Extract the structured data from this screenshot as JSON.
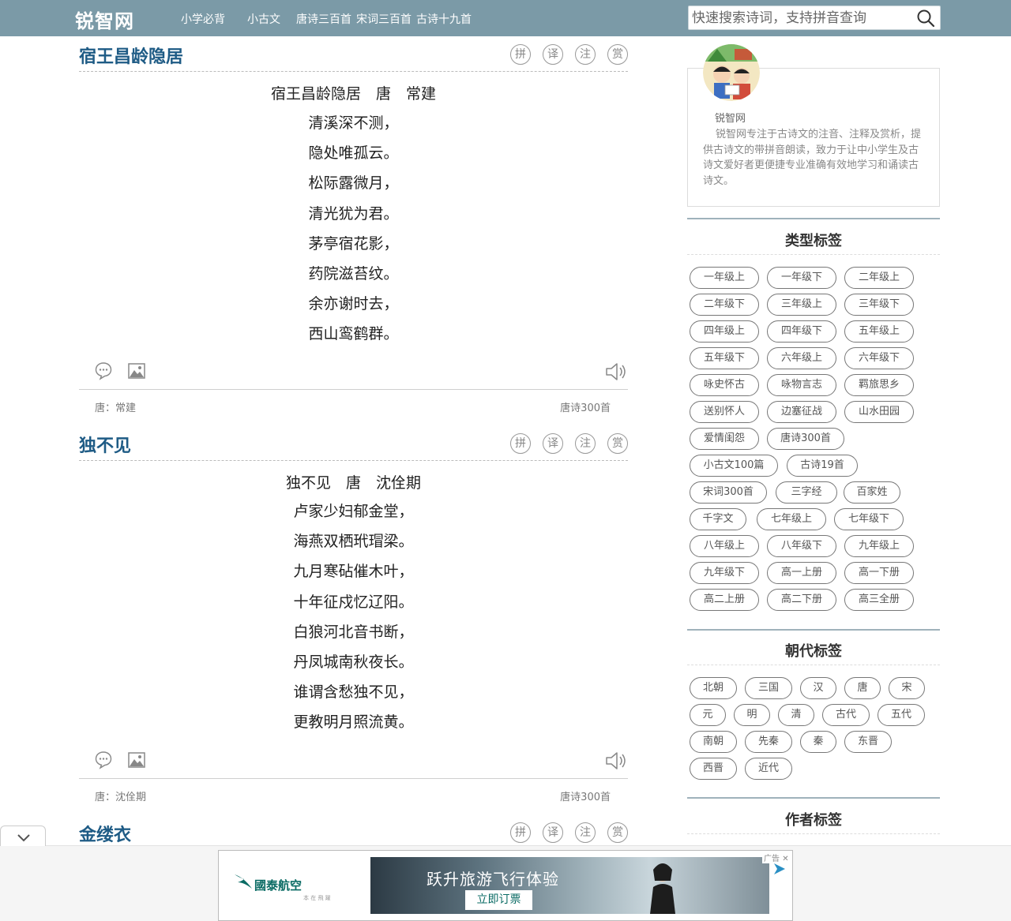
{
  "header": {
    "logo": "锐智网",
    "nav": [
      "小学必背",
      "小古文",
      "唐诗三百首",
      "宋词三百首",
      "古诗十九首"
    ],
    "search_placeholder": "快速搜索诗词，支持拼音查询"
  },
  "poem_tools": [
    "拼",
    "译",
    "注",
    "赏"
  ],
  "poems": [
    {
      "title": "宿王昌龄隐居",
      "heading": "宿王昌龄隐居　唐　常建",
      "lines": [
        "清溪深不测，",
        "隐处唯孤云。",
        "松际露微月，",
        "清光犹为君。",
        "茅亭宿花影，",
        "药院滋苔纹。",
        "余亦谢时去，",
        "西山鸾鹤群。"
      ],
      "meta_left": "唐：常建",
      "meta_right": "唐诗300首"
    },
    {
      "title": "独不见",
      "heading": "独不见　唐　沈佺期",
      "lines": [
        "卢家少妇郁金堂，",
        "海燕双栖玳瑁梁。",
        "九月寒砧催木叶，",
        "十年征戍忆辽阳。",
        "白狼河北音书断，",
        "丹凤城南秋夜长。",
        "谁谓含愁独不见，",
        "更教明月照流黄。"
      ],
      "meta_left": "唐：沈佺期",
      "meta_right": "唐诗300首"
    },
    {
      "title": "金缕衣"
    }
  ],
  "sidebar": {
    "about": {
      "name": "锐智网",
      "text": "锐智网专注于古诗文的注音、注释及赏析，提供古诗文的带拼音朗读，致力于让中小学生及古诗文爱好者更便捷专业准确有效地学习和诵读古诗文。"
    },
    "type_tags": {
      "title": "类型标签",
      "tags": [
        "一年级上",
        "一年级下",
        "二年级上",
        "二年级下",
        "三年级上",
        "三年级下",
        "四年级上",
        "四年级下",
        "五年级上",
        "五年级下",
        "六年级上",
        "六年级下",
        "咏史怀古",
        "咏物言志",
        "羁旅思乡",
        "送别怀人",
        "边塞征战",
        "山水田园",
        "爱情闺怨",
        "唐诗300首",
        "小古文100篇",
        "古诗19首",
        "宋词300首",
        "三字经",
        "百家姓",
        "千字文",
        "七年级上",
        "七年级下",
        "八年级上",
        "八年级下",
        "九年级上",
        "九年级下",
        "高一上册",
        "高一下册",
        "高二上册",
        "高二下册",
        "高三全册"
      ]
    },
    "dynasty_tags": {
      "title": "朝代标签",
      "tags": [
        "北朝",
        "三国",
        "汉",
        "唐",
        "宋",
        "元",
        "明",
        "清",
        "古代",
        "五代",
        "南朝",
        "先秦",
        "秦",
        "东晋",
        "西晋",
        "近代"
      ]
    },
    "author_tags": {
      "title": "作者标签"
    }
  },
  "ad": {
    "brand": "國泰航空",
    "sub": "本 在 飛 躍",
    "headline": "跃升旅游飞行体验",
    "cta": "立即订票",
    "label": "广告"
  },
  "colors": {
    "topbar": "#7b9aa7",
    "title_blue": "#1e5b85",
    "ad_green": "#0a6b64"
  }
}
